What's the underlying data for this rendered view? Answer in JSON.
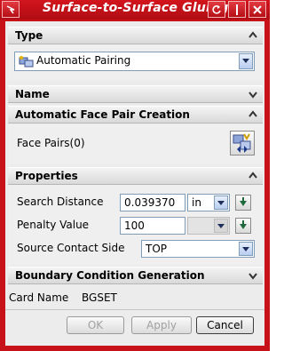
{
  "window": {
    "title": "Surface-to-Surface Gluing",
    "titlebar_buttons": [
      "arrow-icon",
      "reset-icon",
      "close-icon"
    ]
  },
  "type_section": {
    "title": "Type",
    "selected": "Automatic Pairing",
    "icon": "auto-pairing-icon"
  },
  "name_section": {
    "title": "Name"
  },
  "auto_face_section": {
    "title": "Automatic Face Pair Creation",
    "face_pairs_label": "Face Pairs(0)",
    "icon": "face-pair-icon"
  },
  "properties_section": {
    "title": "Properties",
    "search_distance_label": "Search Distance",
    "search_distance_value": "0.039370",
    "search_distance_unit": "in",
    "penalty_value_label": "Penalty Value",
    "penalty_value_value": "100",
    "penalty_value_unit": "",
    "source_contact_label": "Source Contact Side",
    "source_contact_value": "TOP"
  },
  "boundary_section": {
    "title": "Boundary Condition Generation"
  },
  "card": {
    "label": "Card Name",
    "value": "BGSET"
  },
  "footer": {
    "ok_label": "OK",
    "apply_label": "Apply",
    "cancel_label": "Cancel"
  },
  "colors": {
    "titlebar": "#c8121a",
    "client_bg": "#ececec",
    "field_border": "#7f9db9"
  }
}
